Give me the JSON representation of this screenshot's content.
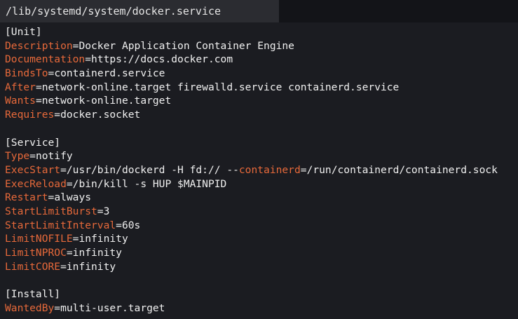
{
  "tab": {
    "title": "/lib/systemd/system/docker.service"
  },
  "colors": {
    "key": "#e7693a",
    "text": "#f0f0f0",
    "background": "#1b1c21",
    "tab": "#2b2c31"
  },
  "lines": [
    {
      "segments": [
        {
          "text": "[Unit]",
          "kind": "hdr"
        }
      ]
    },
    {
      "segments": [
        {
          "text": "Description",
          "kind": "key"
        },
        {
          "text": "=",
          "kind": "eq"
        },
        {
          "text": "Docker Application Container Engine",
          "kind": "val"
        }
      ]
    },
    {
      "segments": [
        {
          "text": "Documentation",
          "kind": "key"
        },
        {
          "text": "=",
          "kind": "eq"
        },
        {
          "text": "https://docs.docker.com",
          "kind": "val"
        }
      ]
    },
    {
      "segments": [
        {
          "text": "BindsTo",
          "kind": "key"
        },
        {
          "text": "=",
          "kind": "eq"
        },
        {
          "text": "containerd.service",
          "kind": "val"
        }
      ]
    },
    {
      "segments": [
        {
          "text": "After",
          "kind": "key"
        },
        {
          "text": "=",
          "kind": "eq"
        },
        {
          "text": "network-online.target firewalld.service containerd.service",
          "kind": "val"
        }
      ]
    },
    {
      "segments": [
        {
          "text": "Wants",
          "kind": "key"
        },
        {
          "text": "=",
          "kind": "eq"
        },
        {
          "text": "network-online.target",
          "kind": "val"
        }
      ]
    },
    {
      "segments": [
        {
          "text": "Requires",
          "kind": "key"
        },
        {
          "text": "=",
          "kind": "eq"
        },
        {
          "text": "docker.socket",
          "kind": "val"
        }
      ]
    },
    {
      "segments": []
    },
    {
      "segments": [
        {
          "text": "[Service]",
          "kind": "hdr"
        }
      ]
    },
    {
      "segments": [
        {
          "text": "Type",
          "kind": "key"
        },
        {
          "text": "=",
          "kind": "eq"
        },
        {
          "text": "notify",
          "kind": "val"
        }
      ]
    },
    {
      "segments": [
        {
          "text": "ExecStart",
          "kind": "key"
        },
        {
          "text": "=",
          "kind": "eq"
        },
        {
          "text": "/usr/bin/dockerd -H fd:// --",
          "kind": "val"
        },
        {
          "text": "containerd",
          "kind": "key"
        },
        {
          "text": "=",
          "kind": "eq"
        },
        {
          "text": "/run/containerd/containerd.sock",
          "kind": "val"
        }
      ]
    },
    {
      "segments": [
        {
          "text": "ExecReload",
          "kind": "key"
        },
        {
          "text": "=",
          "kind": "eq"
        },
        {
          "text": "/bin/kill -s HUP $MAINPID",
          "kind": "val"
        }
      ]
    },
    {
      "segments": [
        {
          "text": "Restart",
          "kind": "key"
        },
        {
          "text": "=",
          "kind": "eq"
        },
        {
          "text": "always",
          "kind": "val"
        }
      ]
    },
    {
      "segments": [
        {
          "text": "StartLimitBurst",
          "kind": "key"
        },
        {
          "text": "=",
          "kind": "eq"
        },
        {
          "text": "3",
          "kind": "val"
        }
      ]
    },
    {
      "segments": [
        {
          "text": "StartLimitInterval",
          "kind": "key"
        },
        {
          "text": "=",
          "kind": "eq"
        },
        {
          "text": "60s",
          "kind": "val"
        }
      ]
    },
    {
      "segments": [
        {
          "text": "LimitNOFILE",
          "kind": "key"
        },
        {
          "text": "=",
          "kind": "eq"
        },
        {
          "text": "infinity",
          "kind": "val"
        }
      ]
    },
    {
      "segments": [
        {
          "text": "LimitNPROC",
          "kind": "key"
        },
        {
          "text": "=",
          "kind": "eq"
        },
        {
          "text": "infinity",
          "kind": "val"
        }
      ]
    },
    {
      "segments": [
        {
          "text": "LimitCORE",
          "kind": "key"
        },
        {
          "text": "=",
          "kind": "eq"
        },
        {
          "text": "infinity",
          "kind": "val"
        }
      ]
    },
    {
      "segments": []
    },
    {
      "segments": [
        {
          "text": "[Install]",
          "kind": "hdr"
        }
      ]
    },
    {
      "segments": [
        {
          "text": "WantedBy",
          "kind": "key"
        },
        {
          "text": "=",
          "kind": "eq"
        },
        {
          "text": "multi-user.target",
          "kind": "val"
        }
      ]
    }
  ]
}
